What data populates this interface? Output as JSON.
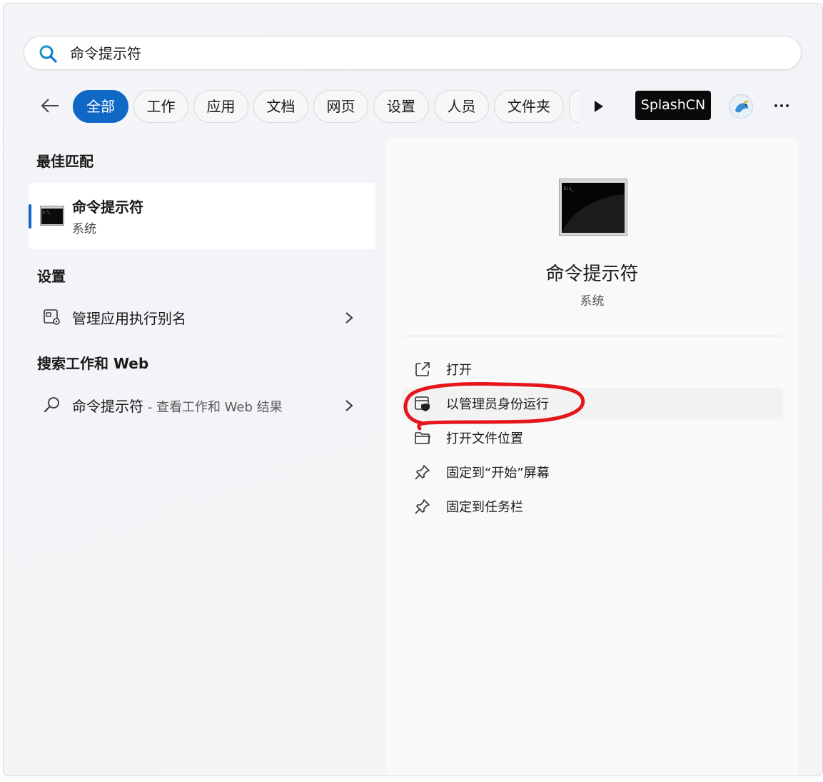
{
  "search": {
    "query": "命令提示符"
  },
  "filters": {
    "items": [
      {
        "label": "全部",
        "active": true
      },
      {
        "label": "工作"
      },
      {
        "label": "应用"
      },
      {
        "label": "文档"
      },
      {
        "label": "网页"
      },
      {
        "label": "设置"
      },
      {
        "label": "人员"
      },
      {
        "label": "文件夹"
      }
    ],
    "account_label": "SplashCN"
  },
  "left": {
    "best_match_title": "最佳匹配",
    "best_match": {
      "name": "命令提示符",
      "type": "系统"
    },
    "settings_title": "设置",
    "settings_item": "管理应用执行别名",
    "web_title": "搜索工作和 Web",
    "web_item": {
      "query": "命令提示符",
      "suffix": " - 查看工作和 Web 结果"
    }
  },
  "right": {
    "app_name": "命令提示符",
    "app_type": "系统",
    "actions": [
      {
        "label": "打开",
        "icon": "open-external-icon"
      },
      {
        "label": "以管理员身份运行",
        "icon": "shield-window-icon"
      },
      {
        "label": "打开文件位置",
        "icon": "folder-icon"
      },
      {
        "label": "固定到“开始”屏幕",
        "icon": "pin-icon"
      },
      {
        "label": "固定到任务栏",
        "icon": "pin-icon"
      }
    ]
  },
  "colors": {
    "accent": "#0f67c6",
    "annotation": "#e4161b"
  }
}
